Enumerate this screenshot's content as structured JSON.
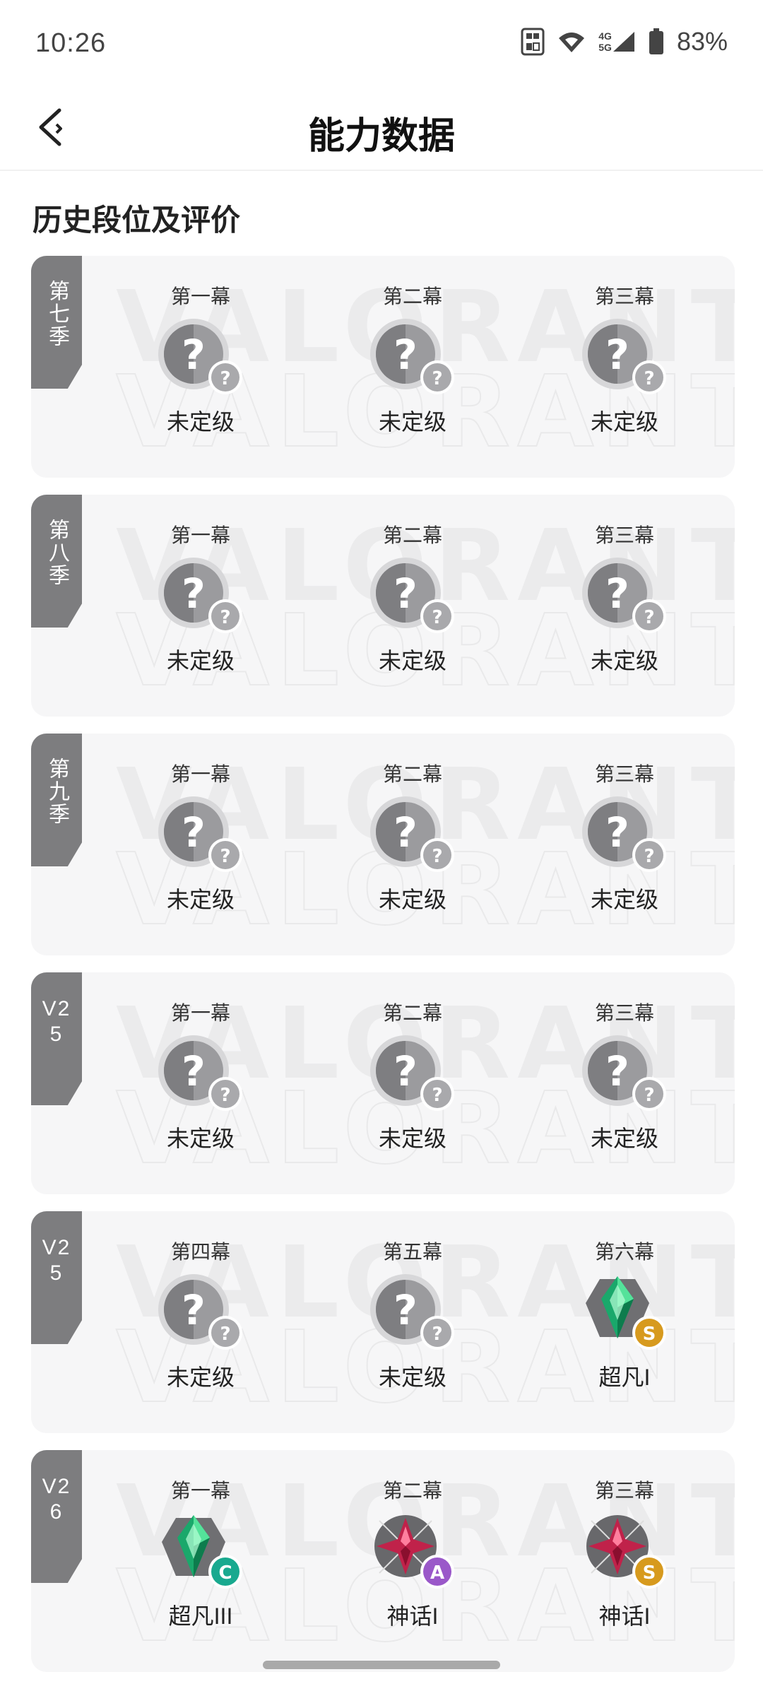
{
  "status_bar": {
    "time": "10:26",
    "network_top": "4G",
    "network_bottom": "5G",
    "battery": "83%",
    "icons": [
      "nfc-icon",
      "wifi-icon",
      "signal-icon",
      "battery-icon"
    ]
  },
  "header": {
    "title": "能力数据",
    "back_icon": "back-arrow-icon"
  },
  "section": {
    "title": "历史段位及评价"
  },
  "watermark_text": "VALORANT",
  "cards": [
    {
      "season": "第七季",
      "acts": [
        {
          "label": "第一幕",
          "rank": "未定级",
          "icon": "unranked",
          "badge": "?"
        },
        {
          "label": "第二幕",
          "rank": "未定级",
          "icon": "unranked",
          "badge": "?"
        },
        {
          "label": "第三幕",
          "rank": "未定级",
          "icon": "unranked",
          "badge": "?"
        }
      ]
    },
    {
      "season": "第八季",
      "acts": [
        {
          "label": "第一幕",
          "rank": "未定级",
          "icon": "unranked",
          "badge": "?"
        },
        {
          "label": "第二幕",
          "rank": "未定级",
          "icon": "unranked",
          "badge": "?"
        },
        {
          "label": "第三幕",
          "rank": "未定级",
          "icon": "unranked",
          "badge": "?"
        }
      ]
    },
    {
      "season": "第九季",
      "acts": [
        {
          "label": "第一幕",
          "rank": "未定级",
          "icon": "unranked",
          "badge": "?"
        },
        {
          "label": "第二幕",
          "rank": "未定级",
          "icon": "unranked",
          "badge": "?"
        },
        {
          "label": "第三幕",
          "rank": "未定级",
          "icon": "unranked",
          "badge": "?"
        }
      ]
    },
    {
      "season": "V25",
      "acts": [
        {
          "label": "第一幕",
          "rank": "未定级",
          "icon": "unranked",
          "badge": "?"
        },
        {
          "label": "第二幕",
          "rank": "未定级",
          "icon": "unranked",
          "badge": "?"
        },
        {
          "label": "第三幕",
          "rank": "未定级",
          "icon": "unranked",
          "badge": "?"
        }
      ]
    },
    {
      "season": "V25",
      "acts": [
        {
          "label": "第四幕",
          "rank": "未定级",
          "icon": "unranked",
          "badge": "?"
        },
        {
          "label": "第五幕",
          "rank": "未定级",
          "icon": "unranked",
          "badge": "?"
        },
        {
          "label": "第六幕",
          "rank": "超凡I",
          "icon": "ascendant",
          "badge": "S",
          "badge_color": "#d79a1e"
        }
      ]
    },
    {
      "season": "V26",
      "acts": [
        {
          "label": "第一幕",
          "rank": "超凡III",
          "icon": "ascendant",
          "badge": "C",
          "badge_color": "#19a98f"
        },
        {
          "label": "第二幕",
          "rank": "神话I",
          "icon": "immortal",
          "badge": "A",
          "badge_color": "#9a58c9"
        },
        {
          "label": "第三幕",
          "rank": "神话I",
          "icon": "immortal",
          "badge": "S",
          "badge_color": "#d79a1e"
        }
      ]
    }
  ]
}
